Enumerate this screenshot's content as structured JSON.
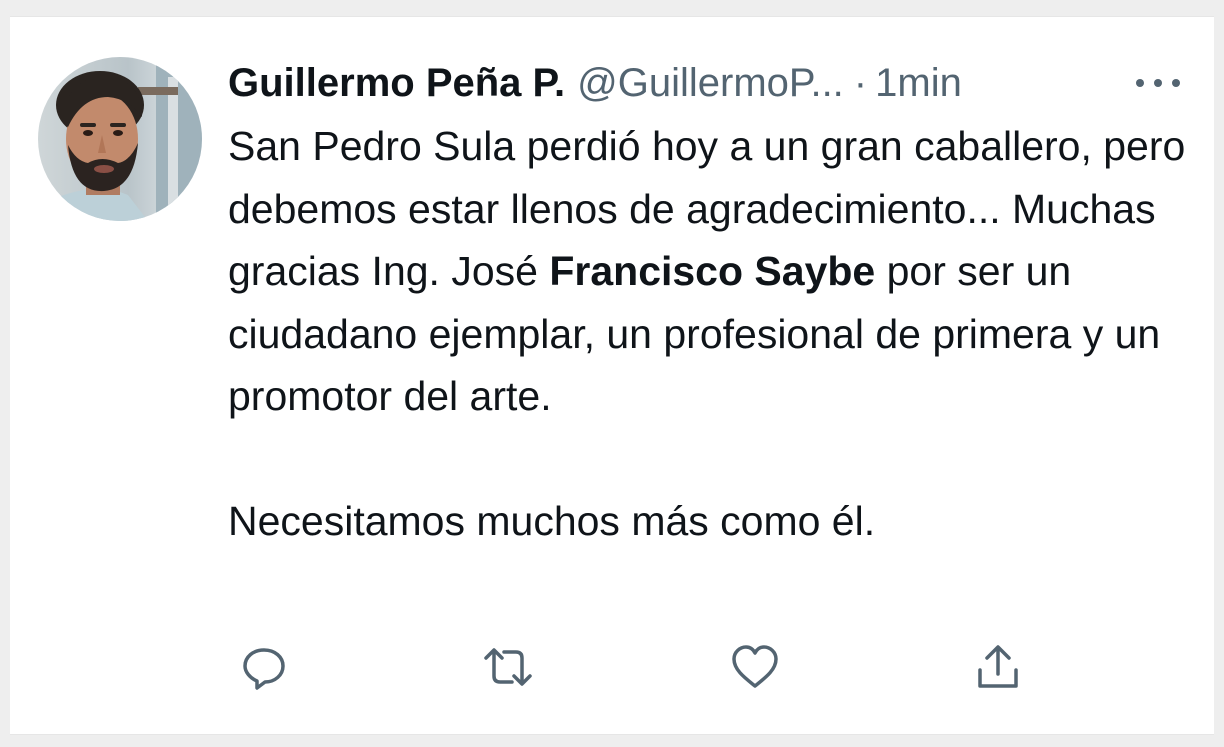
{
  "tweet": {
    "author_name": "Guillermo Peña P.",
    "handle": "@GuillermoP...",
    "separator": "·",
    "time": "1min",
    "text": {
      "line1": "San Pedro Sula perdió hoy a un gran caballero, pero debemos estar llenos de agradecimiento... Muchas gracias Ing. José ",
      "bold": "Francisco Saybe",
      "line1_end": " por ser un ciudadano ejemplar, un profesional de primera y un promotor del arte.",
      "line2": "Necesitamos muchos más como él."
    }
  },
  "icons": {
    "avatar": "profile-photo",
    "more": "more-icon",
    "reply": "reply-icon",
    "retweet": "retweet-icon",
    "like": "like-icon",
    "share": "share-icon"
  },
  "colors": {
    "text_primary": "#0f1419",
    "text_secondary": "#536471",
    "background": "#ffffff"
  }
}
